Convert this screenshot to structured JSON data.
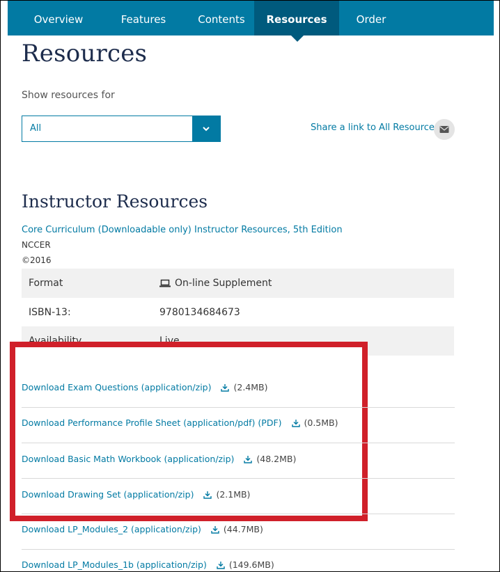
{
  "nav": {
    "tabs": [
      {
        "label": "Overview"
      },
      {
        "label": "Features"
      },
      {
        "label": "Contents"
      },
      {
        "label": "Resources"
      },
      {
        "label": "Order"
      }
    ],
    "active": "Resources"
  },
  "page": {
    "title": "Resources",
    "show_label": "Show resources for",
    "select": {
      "value": "All"
    },
    "share_link": "Share a link to All Resources"
  },
  "instructor": {
    "heading": "Instructor Resources",
    "product_link": "Core Curriculum (Downloadable only) Instructor Resources, 5th Edition",
    "author": "NCCER",
    "year": "©2016",
    "specs": [
      {
        "label": "Format",
        "value": "On-line Supplement"
      },
      {
        "label": "ISBN-13:",
        "value": "9780134684673"
      },
      {
        "label": "Availability",
        "value": "Live"
      }
    ]
  },
  "downloads": [
    {
      "label": "Download Exam Questions (application/zip)",
      "size": "(2.4MB)"
    },
    {
      "label": "Download Performance Profile Sheet (application/pdf) (PDF)",
      "size": "(0.5MB)"
    },
    {
      "label": "Download Basic Math Workbook (application/zip)",
      "size": "(48.2MB)"
    },
    {
      "label": "Download Drawing Set (application/zip)",
      "size": "(2.1MB)"
    },
    {
      "label": "Download LP_Modules_2 (application/zip)",
      "size": "(44.7MB)"
    },
    {
      "label": "Download LP_Modules_1b (application/zip)",
      "size": "(149.6MB)"
    }
  ],
  "colors": {
    "primary": "#027aa3",
    "nav_active": "#005a7d",
    "heading": "#1d2c4c",
    "highlight_box": "#d0202a"
  },
  "icons": {
    "dropdown": "chevron-down-icon",
    "share": "mail-icon",
    "format": "laptop-icon",
    "download": "download-icon"
  }
}
